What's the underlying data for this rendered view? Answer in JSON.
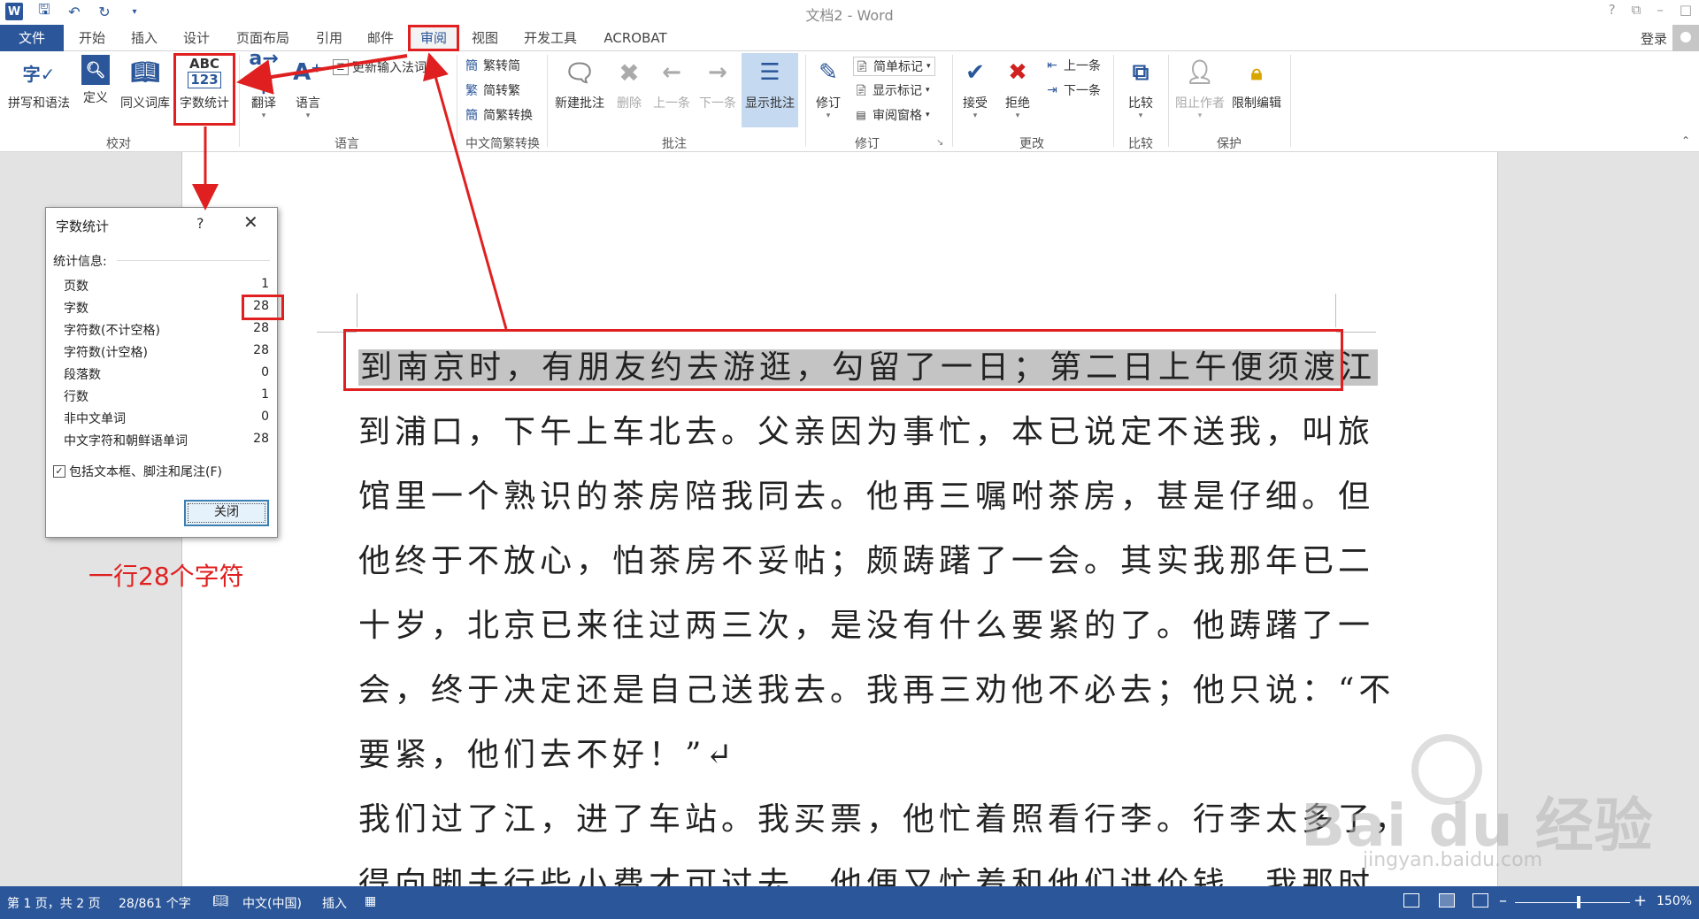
{
  "window": {
    "title": "文档2 - Word",
    "app_icon_letter": "W",
    "controls": [
      "?",
      "⧉",
      "–",
      "□"
    ]
  },
  "tabs": [
    {
      "label": "文件"
    },
    {
      "label": "开始"
    },
    {
      "label": "插入"
    },
    {
      "label": "设计"
    },
    {
      "label": "页面布局"
    },
    {
      "label": "引用"
    },
    {
      "label": "邮件"
    },
    {
      "label": "审阅"
    },
    {
      "label": "视图"
    },
    {
      "label": "开发工具"
    },
    {
      "label": "ACROBAT"
    }
  ],
  "account": {
    "login_label": "登录"
  },
  "ribbon": {
    "proofing": {
      "spelling": "拼写和语法",
      "define": "定义",
      "thesaurus": "同义词库",
      "wordcount": "字数统计",
      "wordcount_icon_top": "ABC",
      "wordcount_icon_bottom": "123",
      "group_label": "校对"
    },
    "language": {
      "translate": "翻译",
      "language": "语言",
      "update_ime": "更新输入法词典",
      "group_label": "语言"
    },
    "chinese": {
      "to_simplified": "繁转简",
      "to_traditional": "简转繁",
      "convert": "简繁转换",
      "group_label": "中文简繁转换"
    },
    "comments": {
      "new": "新建批注",
      "delete": "删除",
      "previous": "上一条",
      "next": "下一条",
      "show": "显示批注",
      "group_label": "批注"
    },
    "tracking": {
      "track": "修订",
      "simple_markup": "简单标记",
      "show_markup": "显示标记",
      "review_pane": "审阅窗格",
      "group_label": "修订"
    },
    "changes": {
      "accept": "接受",
      "reject": "拒绝",
      "previous": "上一条",
      "next": "下一条",
      "group_label": "更改"
    },
    "compare": {
      "compare": "比较",
      "group_label": "比较"
    },
    "protect": {
      "block_authors": "阻止作者",
      "restrict": "限制编辑",
      "group_label": "保护"
    }
  },
  "dialog": {
    "title": "字数统计",
    "help": "?",
    "close_x": "✕",
    "section": "统计信息:",
    "rows": [
      {
        "label": "页数",
        "value": "1"
      },
      {
        "label": "字数",
        "value": "28"
      },
      {
        "label": "字符数(不计空格)",
        "value": "28"
      },
      {
        "label": "字符数(计空格)",
        "value": "28"
      },
      {
        "label": "段落数",
        "value": "0"
      },
      {
        "label": "行数",
        "value": "1"
      },
      {
        "label": "非中文单词",
        "value": "0"
      },
      {
        "label": "中文字符和朝鲜语单词",
        "value": "28"
      }
    ],
    "checkbox_label": "包括文本框、脚注和尾注(F)",
    "checkbox_checked": true,
    "close_button": "关闭"
  },
  "annotation": "一行28个字符",
  "document": {
    "selected_line": "到南京时，有朋友约去游逛，勾留了一日；第二日上午便须渡江",
    "lines": [
      "到浦口，下午上车北去。父亲因为事忙，本已说定不送我，叫旅",
      "馆里一个熟识的茶房陪我同去。他再三嘱咐茶房，甚是仔细。但",
      "他终于不放心，怕茶房不妥帖；颇踌躇了一会。其实我那年已二",
      "十岁，北京已来往过两三次，是没有什么要紧的了。他踌躇了一",
      "会，终于决定还是自己送我去。我再三劝他不必去；他只说：“不",
      "要紧，他们去不好！”↵",
      "我们过了江，进了车站。我买票，他忙着照看行李。行李太多了，",
      "得向脚夫行些小费才可过去。他便又忙着和他们讲价钱。我那时"
    ]
  },
  "status": {
    "page": "第 1 页，共 2 页",
    "words": "28/861 个字",
    "language": "中文(中国)",
    "mode": "插入",
    "zoom": "150%"
  },
  "watermark": {
    "brand": "Bai du 经验",
    "url": "jingyan.baidu.com"
  },
  "colors": {
    "accent": "#2b579a",
    "highlight_red": "#e02020"
  }
}
